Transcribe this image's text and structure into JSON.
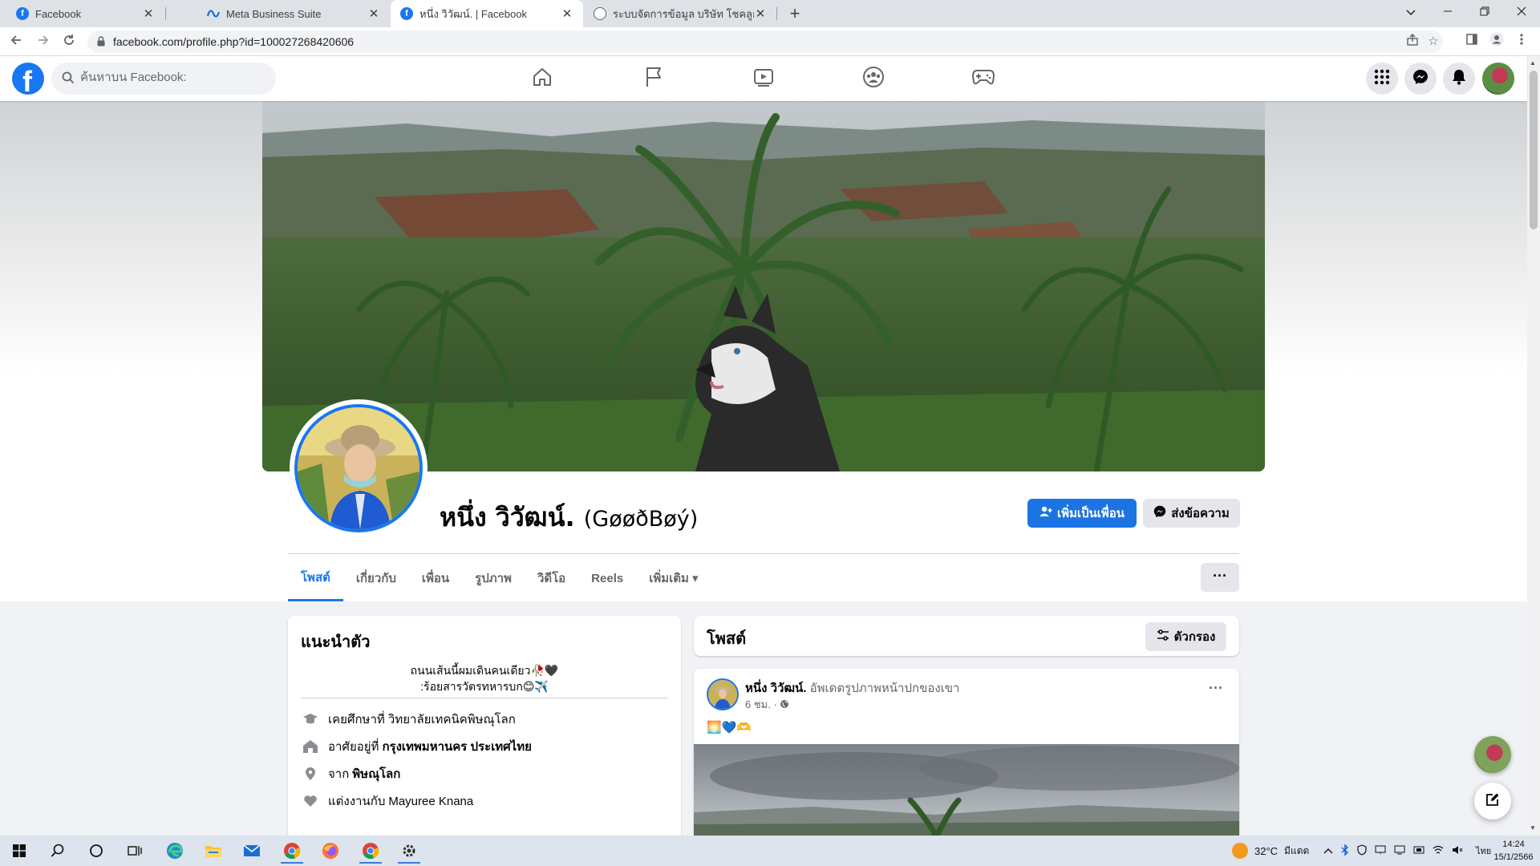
{
  "browser": {
    "tabs": [
      {
        "title": "Facebook",
        "icon": "facebook-favicon",
        "active": false
      },
      {
        "title": "Meta Business Suite",
        "icon": "meta-favicon",
        "active": false
      },
      {
        "title": "หนึ่ง วิวัฒน์. | Facebook",
        "icon": "facebook-favicon",
        "active": true
      },
      {
        "title": "ระบบจัดการข้อมูล บริษัท โชคลูกน็อต ฯ",
        "icon": "globe-favicon",
        "active": false
      }
    ],
    "close_glyph": "✕",
    "new_tab_glyph": "+",
    "url": "facebook.com/profile.php?id=100027268420606"
  },
  "fb_header": {
    "logo_letter": "f",
    "search_placeholder": "ค้นหาบน Facebook:",
    "nav_items": [
      "home-icon",
      "pages-flag-icon",
      "watch-video-icon",
      "groups-icon",
      "gaming-icon"
    ],
    "right_icons": [
      "menu-grid-icon",
      "messenger-icon",
      "notifications-bell-icon",
      "account-avatar"
    ]
  },
  "profile": {
    "name": "หนึ่ง วิวัฒน์.",
    "nickname": "(GøøðBøý)",
    "add_friend_label": "เพิ่มเป็นเพื่อน",
    "message_label": "ส่งข้อความ",
    "tabs": [
      {
        "label": "โพสต์",
        "active": true
      },
      {
        "label": "เกี่ยวกับ",
        "active": false
      },
      {
        "label": "เพื่อน",
        "active": false
      },
      {
        "label": "รูปภาพ",
        "active": false
      },
      {
        "label": "วิดีโอ",
        "active": false
      },
      {
        "label": "Reels",
        "active": false
      },
      {
        "label": "เพิ่มเติม ▾",
        "active": false
      }
    ],
    "more_label": "···"
  },
  "intro": {
    "title": "แนะนำตัว",
    "bio_line1": "ถนนเส้นนี้ผมเดินคนเดียว🥀🖤",
    "bio_line2": ":ร้อยสารวัตรทหารบก😊✈️",
    "rows": [
      {
        "icon": "graduation-cap-icon",
        "text": "เคยศึกษาที่ วิทยาลัยเทคนิคพิษณุโลก",
        "bold": ""
      },
      {
        "icon": "home-icon",
        "text": "อาศัยอยู่ที่",
        "bold": "กรุงเทพมหานคร ประเทศไทย"
      },
      {
        "icon": "location-pin-icon",
        "text": "จาก",
        "bold": "พิษณุโลก"
      },
      {
        "icon": "heart-icon",
        "text": "แต่งงานกับ",
        "bold": "Mayuree Knana"
      }
    ]
  },
  "posts": {
    "title": "โพสต์",
    "filter_label": "ตัวกรอง",
    "items": [
      {
        "author": "หนึ่ง วิวัฒน์.",
        "action": "อัพเดตรูปภาพหน้าปกของเขา",
        "time": "6 ชม. ·",
        "privacy_icon": "globe-icon",
        "content": "🌅💙🫶",
        "menu": "···"
      }
    ]
  },
  "taskbar": {
    "weather": "32°C",
    "weather_desc": "มีแดด",
    "language": "ไทย",
    "time": "14:24",
    "date": "15/1/2566",
    "apps": [
      "windows-start-icon",
      "search-icon",
      "cortana-icon",
      "task-view-icon",
      "edge-icon",
      "file-explorer-icon",
      "mail-icon",
      "chrome-icon",
      "firefox-icon",
      "chrome-icon",
      "settings-gear-icon"
    ]
  },
  "colors": {
    "fb_blue": "#1877f2",
    "button_grey": "#e4e6eb",
    "page_bg": "#f0f2f5",
    "secondary_text": "#65676b"
  }
}
